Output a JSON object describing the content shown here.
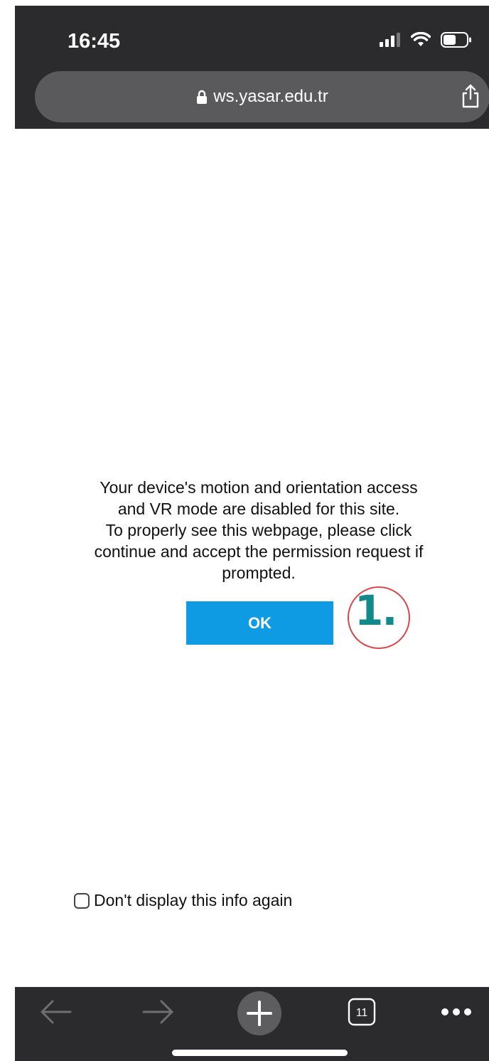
{
  "status_bar": {
    "time": "16:45"
  },
  "address_bar": {
    "url": "ws.yasar.edu.tr"
  },
  "dialog": {
    "message_lines": [
      "Your device's motion and orientation access",
      "and VR mode are disabled for this site.",
      "To properly see this webpage, please click",
      "continue and accept the permission request if",
      "prompted."
    ],
    "ok_label": "OK"
  },
  "annotation": {
    "label": "1."
  },
  "checkbox": {
    "label": "Don't display this info again",
    "checked": false
  },
  "toolbar": {
    "tab_count": "11"
  },
  "colors": {
    "chrome_bg": "#2b2b2d",
    "address_bar_bg": "#5a5a5c",
    "ok_button_bg": "#0e9be3",
    "annotation_circle": "#d9464a",
    "annotation_label": "#138a8a"
  },
  "icons": [
    "signal-icon",
    "wifi-icon",
    "battery-icon",
    "lock-icon",
    "share-icon",
    "back-arrow-icon",
    "forward-arrow-icon",
    "new-tab-plus-icon",
    "tabs-icon",
    "more-icon"
  ]
}
